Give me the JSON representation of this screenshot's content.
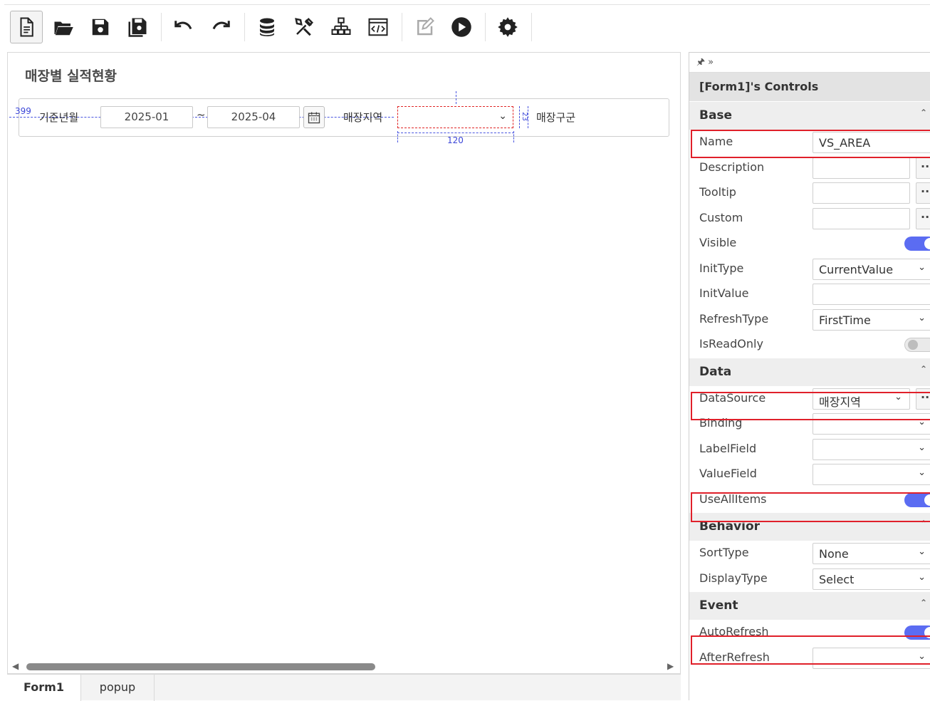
{
  "toolbar": {
    "buttons": [
      "new-file",
      "open-folder",
      "save",
      "save-all",
      "undo",
      "redo",
      "database",
      "tools",
      "hierarchy",
      "code",
      "edit",
      "run",
      "settings"
    ]
  },
  "designer": {
    "form_title": "매장별 실적현황",
    "search": {
      "base_month_label": "기준년월",
      "from_value": "2025-01",
      "range_sep": "~",
      "to_value": "2025-04",
      "area_label": "매장지역",
      "area_value": "",
      "class_label": "매장구군"
    },
    "guides": {
      "left_offset": "399",
      "width": "120",
      "gap": "23"
    },
    "tabs": [
      "Form1",
      "popup"
    ]
  },
  "props": {
    "header_icons": "🖈 »",
    "title": "[Form1]'s Controls",
    "groups": {
      "base": "Base",
      "data": "Data",
      "behavior": "Behavior",
      "event": "Event"
    },
    "base_rows": {
      "name": {
        "label": "Name",
        "value": "VS_AREA"
      },
      "description": {
        "label": "Description",
        "value": ""
      },
      "tooltip": {
        "label": "Tooltip",
        "value": ""
      },
      "custom": {
        "label": "Custom",
        "value": ""
      },
      "visible": {
        "label": "Visible"
      },
      "inittype": {
        "label": "InitType",
        "value": "CurrentValue"
      },
      "initvalue": {
        "label": "InitValue",
        "value": ""
      },
      "refreshtype": {
        "label": "RefreshType",
        "value": "FirstTime"
      },
      "isreadonly": {
        "label": "IsReadOnly"
      }
    },
    "data_rows": {
      "datasource": {
        "label": "DataSource",
        "value": "매장지역"
      },
      "binding": {
        "label": "Binding",
        "value": ""
      },
      "labelfield": {
        "label": "LabelField",
        "value": ""
      },
      "valuefield": {
        "label": "ValueField",
        "value": ""
      },
      "useallitems": {
        "label": "UseAllItems"
      }
    },
    "behavior_rows": {
      "sorttype": {
        "label": "SortType",
        "value": "None"
      },
      "displaytype": {
        "label": "DisplayType",
        "value": "Select"
      }
    },
    "event_rows": {
      "autorefresh": {
        "label": "AutoRefresh"
      },
      "afterrefresh": {
        "label": "AfterRefresh",
        "value": ""
      }
    },
    "toggles": {
      "visible": true,
      "isreadonly": false,
      "useallitems": true,
      "autorefresh": true
    }
  }
}
